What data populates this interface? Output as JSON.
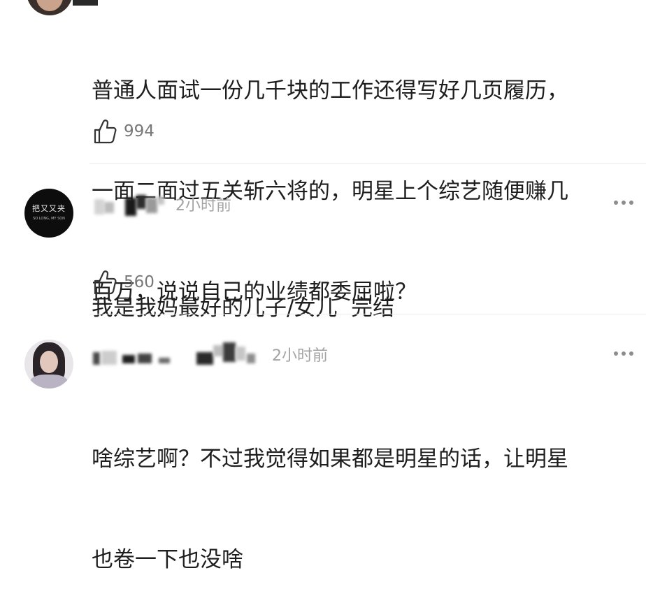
{
  "comments": [
    {
      "text_lines": [
        "普通人面试一份几千块的工作还得写好几页履历，",
        "一面二面过五关斩六将的，明星上个综艺随便赚几",
        "百万，说说自己的业绩都委屈啦？"
      ],
      "likes": "994"
    },
    {
      "avatar_icon": "dark-logo-avatar",
      "avatar_text": "把又又夹",
      "avatar_subtext": "SO LONG, MY SON",
      "time": "2小时前",
      "text_lines": [
        "我是我妈最好的儿子/女儿  完结"
      ],
      "likes": "560"
    },
    {
      "avatar_icon": "woman-portrait-avatar",
      "time": "2小时前",
      "text_lines": [
        "啥综艺啊？不过我觉得如果都是明星的话，让明星",
        "也卷一下也没啥"
      ]
    }
  ],
  "icons": {
    "like": "thumbs-up-icon",
    "more": "more-dots-icon"
  },
  "colors": {
    "text": "#1e1e1e",
    "muted": "#777777",
    "time": "#a3a3a3",
    "divider": "#ececec"
  }
}
